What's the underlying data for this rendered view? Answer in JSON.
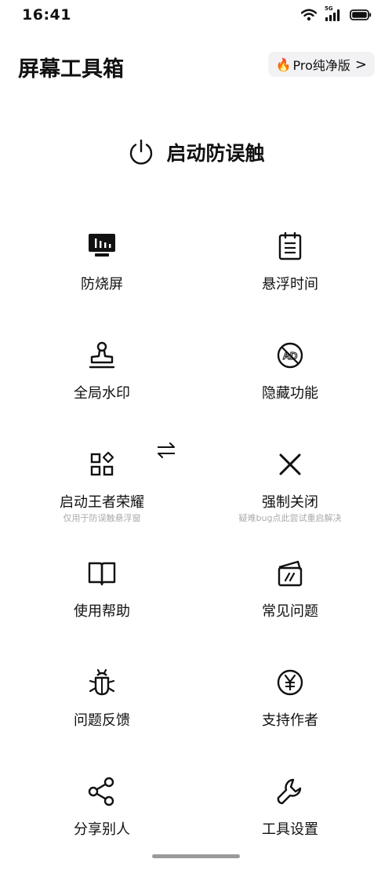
{
  "status_bar": {
    "time": "16:41",
    "network": "5G"
  },
  "header": {
    "title": "屏幕工具箱",
    "pro_label": "Pro纯净版",
    "pro_chevron": ">"
  },
  "main_toggle": {
    "label": "启动防误触"
  },
  "tools": [
    {
      "label": "防烧屏",
      "icon": "burn-screen-icon"
    },
    {
      "label": "悬浮时间",
      "icon": "calendar-icon"
    },
    {
      "label": "全局水印",
      "icon": "stamp-icon"
    },
    {
      "label": "隐藏功能",
      "icon": "no-ad-icon"
    },
    {
      "label": "启动王者荣耀",
      "sublabel": "仅用于防误触悬浮窗",
      "icon": "apps-grid-icon"
    },
    {
      "label": "强制关闭",
      "sublabel": "疑难bug点此尝试重启解决",
      "icon": "close-icon"
    },
    {
      "label": "使用帮助",
      "icon": "book-icon"
    },
    {
      "label": "常见问题",
      "icon": "cards-icon"
    },
    {
      "label": "问题反馈",
      "icon": "bug-icon"
    },
    {
      "label": "支持作者",
      "icon": "yen-coin-icon"
    },
    {
      "label": "分享别人",
      "icon": "share-icon"
    },
    {
      "label": "工具设置",
      "icon": "wrench-icon"
    }
  ]
}
